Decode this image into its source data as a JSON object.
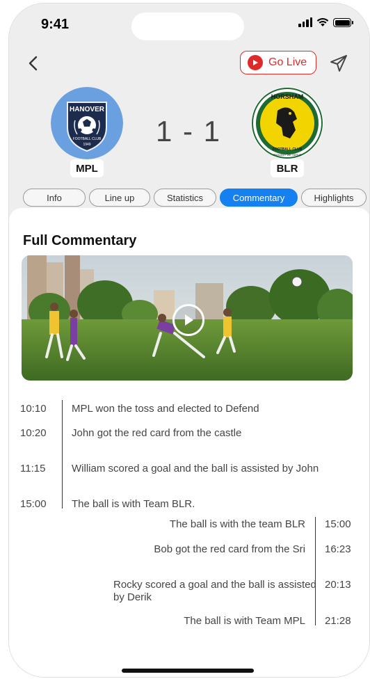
{
  "status_bar": {
    "time": "9:41"
  },
  "header": {
    "go_live_label": "Go Live"
  },
  "match": {
    "score": "1 - 1",
    "home": {
      "tag": "MPL",
      "logo_top": "HANOVER",
      "logo_sub": "FOOTBALL CLUB",
      "logo_year": "1949"
    },
    "away": {
      "tag": "BLR",
      "logo_top": "HORSHAM",
      "logo_sub": "FOOTBALL CLUB",
      "logo_motto": "PROUDLY WE SERVE"
    }
  },
  "tabs": [
    "Info",
    "Line up",
    "Statistics",
    "Commentary",
    "Highlights"
  ],
  "active_tab": "Commentary",
  "commentary": {
    "title": "Full Commentary",
    "left_entries": [
      {
        "time": "10:10",
        "text": "MPL won the toss and elected to Defend"
      },
      {
        "time": "10:20",
        "text": "John got the red card from the castle"
      },
      {
        "time": "11:15",
        "text": "William scored a goal and the ball is assisted by John"
      },
      {
        "time": "15:00",
        "text": "The ball is with Team BLR."
      }
    ],
    "right_entries": [
      {
        "time": "15:00",
        "text": "The ball is with the team BLR"
      },
      {
        "time": "16:23",
        "text": "Bob got the red card from the Sri"
      },
      {
        "time": "20:13",
        "text": "Rocky scored a goal and the ball is assisted by Derik"
      },
      {
        "time": "21:28",
        "text": "The ball is with Team MPL"
      }
    ]
  },
  "colors": {
    "accent": "#1580f0",
    "live": "#e02a2a",
    "header_bg": "#eeeeee"
  }
}
